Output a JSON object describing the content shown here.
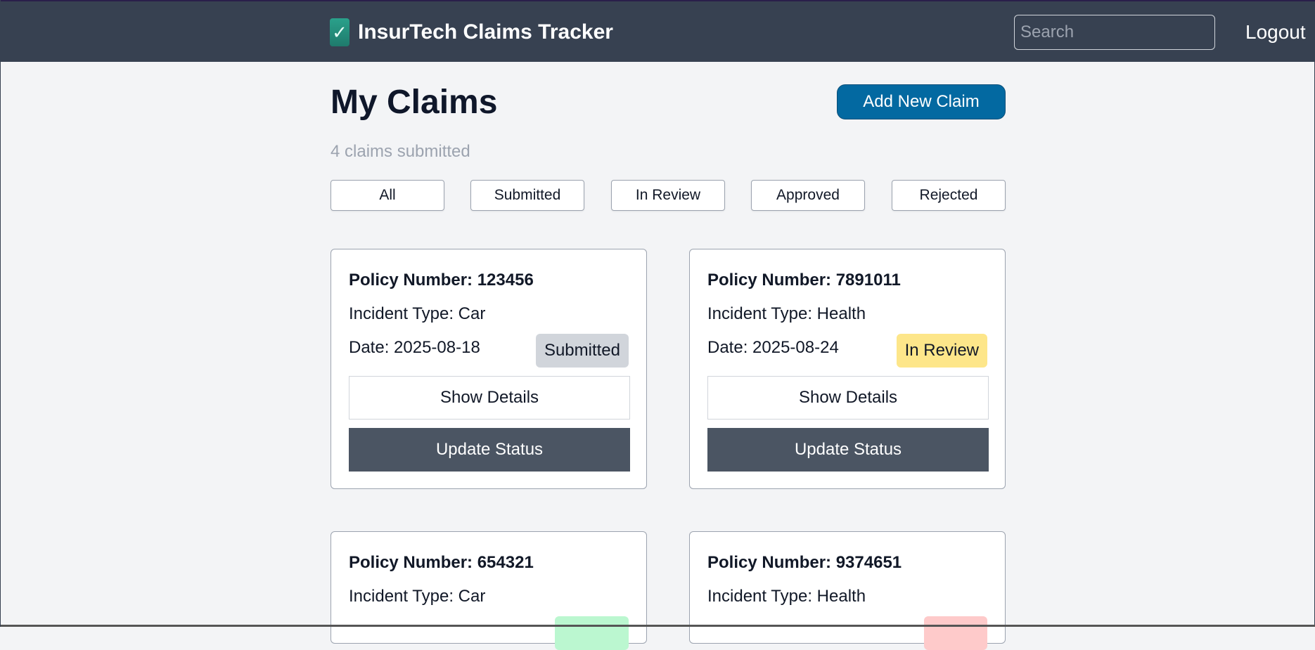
{
  "header": {
    "brand_icon": "check-icon",
    "brand_title": "InsurTech Claims Tracker",
    "search_placeholder": "Search",
    "logout_label": "Logout"
  },
  "main": {
    "title": "My Claims",
    "add_button": "Add New Claim",
    "subtitle": "4 claims submitted",
    "filters": [
      "All",
      "Submitted",
      "In Review",
      "Approved",
      "Rejected"
    ]
  },
  "claims": [
    {
      "policy": "Policy Number: 123456",
      "incident": "Incident Type: Car",
      "date": "Date: 2025-08-18",
      "status": "Submitted",
      "status_color": "#d1d5db",
      "details_label": "Show Details",
      "update_label": "Update Status"
    },
    {
      "policy": "Policy Number: 7891011",
      "incident": "Incident Type: Health",
      "date": "Date: 2025-08-24",
      "status": "In Review",
      "status_color": "#fde68a",
      "details_label": "Show Details",
      "update_label": "Update Status"
    },
    {
      "policy": "Policy Number: 654321",
      "incident": "Incident Type: Car",
      "status_color": "#bbf7d0"
    },
    {
      "policy": "Policy Number: 9374651",
      "incident": "Incident Type: Health",
      "status_color": "#fecaca"
    }
  ]
}
